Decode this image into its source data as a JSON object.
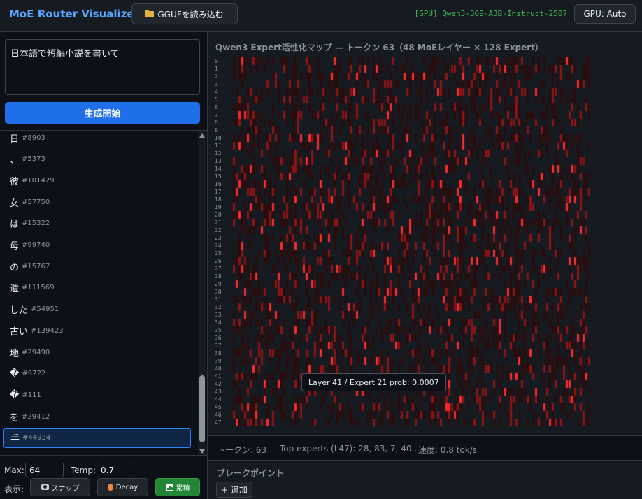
{
  "header": {
    "app_title": "MoE Router Visualizer",
    "load_button": "GGUFを読み込む",
    "status": "[GPU] Qwen3-30B-A3B-Instruct-2507",
    "gpu_button": "GPU: Auto"
  },
  "prompt": {
    "value": "日本語で短編小説を書いて",
    "generate_button": "生成開始"
  },
  "tokens": [
    {
      "text": "日",
      "id": "#8903"
    },
    {
      "text": "、",
      "id": "#5373"
    },
    {
      "text": "彼",
      "id": "#101429"
    },
    {
      "text": "女",
      "id": "#57750"
    },
    {
      "text": "は",
      "id": "#15322"
    },
    {
      "text": "母",
      "id": "#99740"
    },
    {
      "text": "の",
      "id": "#15767"
    },
    {
      "text": "遺",
      "id": "#111569"
    },
    {
      "text": "した",
      "id": "#54951"
    },
    {
      "text": "古い",
      "id": "#139423"
    },
    {
      "text": "地",
      "id": "#29490"
    },
    {
      "text": "�",
      "id": "#9722"
    },
    {
      "text": "�",
      "id": "#111"
    },
    {
      "text": "を",
      "id": "#29412"
    },
    {
      "text": "手",
      "id": "#44934",
      "selected": true
    }
  ],
  "controls": {
    "max_label": "Max:",
    "max_value": "64",
    "temp_label": "Temp:",
    "temp_value": "0.7",
    "display_label": "表示:",
    "snap_button": "スナップ",
    "decay_button": "Decay",
    "cumulative_button": "累積",
    "active_mode": "cumulative"
  },
  "map": {
    "title": "Qwen3 Expert活性化マップ — トークン 63（48 MoEレイヤー × 128 Expert）",
    "layers": 48,
    "experts": 128,
    "tooltip": "Layer 41 / Expert 21 prob: 0.0007",
    "colors": {
      "low": "#2a0c0c",
      "mid": "#8e1414",
      "high": "#ff2a2a",
      "background": "#161b22"
    }
  },
  "stats": {
    "tokens": "トークン: 63",
    "top_experts": "Top experts (L47): 28, 83, 7, 40...",
    "speed": "速度: 0.8 tok/s"
  },
  "breakpoints": {
    "title": "ブレークポイント",
    "add_button": "+ 追加"
  }
}
